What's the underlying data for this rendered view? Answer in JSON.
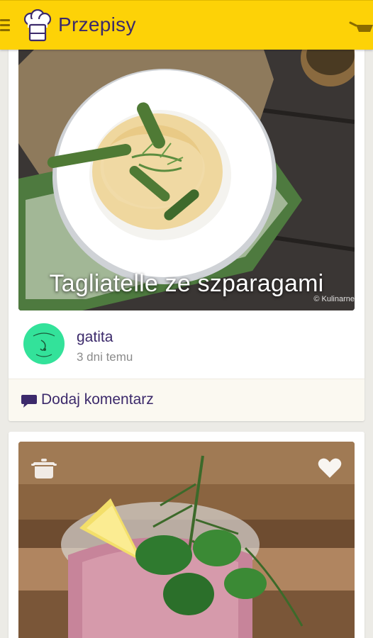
{
  "app": {
    "title": "Przepisy"
  },
  "icons": {
    "menu": "menu-icon",
    "logo": "chef-hat-icon",
    "cart": "shopping-basket-icon",
    "comment": "speech-bubble-icon",
    "pot": "cooking-pot-icon",
    "heart": "heart-icon"
  },
  "colors": {
    "appbar": "#fdd207",
    "accent": "#3c2a6b",
    "avatar_bg": "#33e29a"
  },
  "feed": [
    {
      "caption": "Tagliatelle ze szparagami",
      "photo_credit": "© Kulinarne",
      "author": {
        "name": "gatita",
        "time": "3 dni temu"
      },
      "comment_label": "Dodaj komentarz"
    },
    {
      "caption": "",
      "photo_credit": ""
    }
  ]
}
